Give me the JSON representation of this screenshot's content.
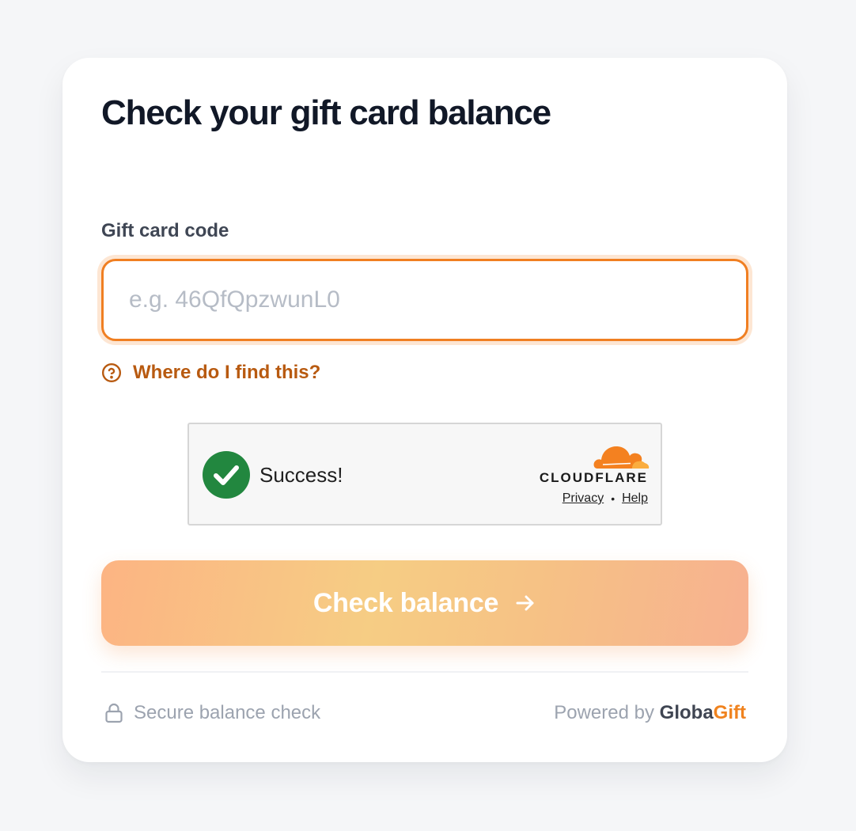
{
  "form": {
    "title": "Check your gift card balance",
    "code_label": "Gift card code",
    "code_value": "",
    "code_placeholder": "e.g. 46QfQpzwunL0",
    "help_icon": "question-circle-icon",
    "help_link": "Where do I find this?",
    "submit_label": "Check balance",
    "submit_icon": "arrow-right-icon"
  },
  "captcha": {
    "status": "Success!",
    "status_icon": "check-circle-icon",
    "provider": "CLOUDFLARE",
    "provider_icon": "cloudflare-cloud-icon",
    "privacy_link": "Privacy",
    "separator": "•",
    "help_link": "Help"
  },
  "footer": {
    "secure_icon": "lock-icon",
    "secure_text": "Secure balance check",
    "powered_prefix": "Powered by",
    "brand_part1": "Globa",
    "brand_part2": "Gift"
  },
  "colors": {
    "page_background": "#f5f6f8",
    "title_text": "#111827",
    "input_border": "#f07f22",
    "input_focus_ring": "#fde6d3",
    "help_link": "#b85a10",
    "captcha_success_green": "#22873f",
    "cloudflare_orange": "#f48120",
    "button_gradient_start": "#fcb483",
    "button_gradient_mid": "#f6cd84",
    "button_gradient_end": "#f7b190",
    "footer_muted_text": "#9ca3af",
    "brand_dark": "#3f4552",
    "brand_orange": "#f0831f"
  }
}
